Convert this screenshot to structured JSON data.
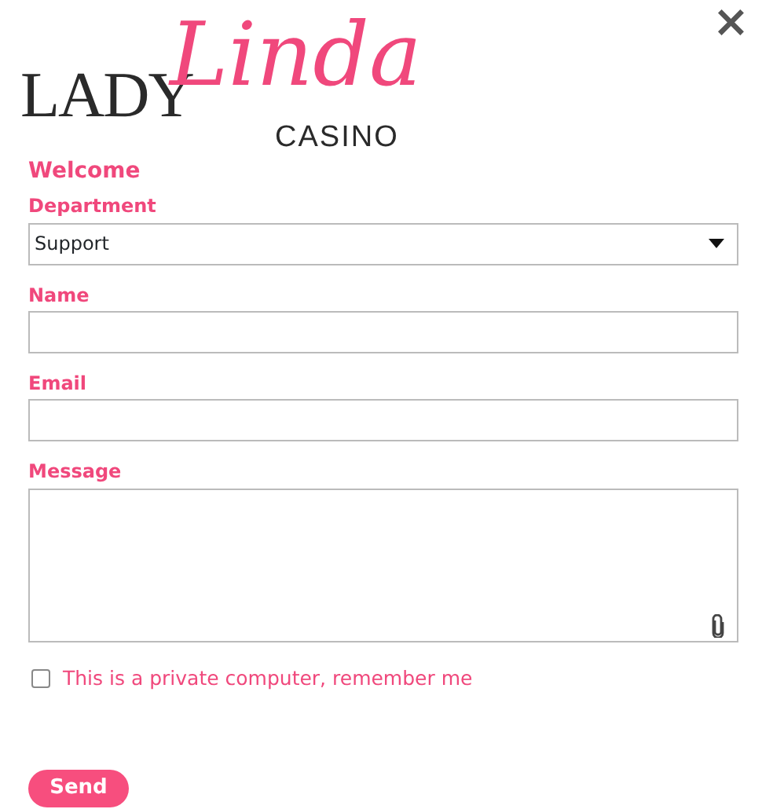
{
  "logo": {
    "word_1": "LADY",
    "word_2": "Linda",
    "word_3": "CASINO"
  },
  "close": "×",
  "heading": "Welcome",
  "fields": [
    {
      "kind": "select",
      "label": "Department",
      "value": "Support"
    },
    {
      "kind": "text",
      "label": "Name"
    },
    {
      "kind": "text",
      "label": "Email"
    },
    {
      "kind": "textarea",
      "label": "Message"
    }
  ],
  "remember": {
    "label": "This is a private computer, remember me",
    "checked": false
  },
  "send_button": "Send"
}
